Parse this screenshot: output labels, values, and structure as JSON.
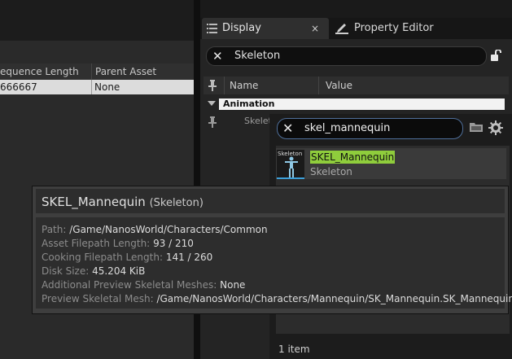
{
  "left_table": {
    "columns": [
      "equence Length",
      "Parent Asset"
    ],
    "row": [
      "666667",
      "None"
    ]
  },
  "tabs": {
    "display": {
      "label": "Display",
      "close": "×"
    },
    "property_editor": {
      "label": "Property Editor"
    }
  },
  "details_search": {
    "value": "Skeleton",
    "clear": "✕"
  },
  "property_grid": {
    "headers": [
      "Name",
      "Value"
    ],
    "category": "Animation",
    "row_label": "Skelet"
  },
  "picker": {
    "search": {
      "value": "skel_mannequin",
      "clear": "✕"
    },
    "items": [
      {
        "name": "SKEL_Mannequin",
        "type": "Skeleton",
        "thumb_label": "Skeleton"
      }
    ],
    "count": "1 item",
    "highlight_color": "#8fcd3c"
  },
  "tooltip": {
    "name": "SKEL_Mannequin",
    "type": "(Skeleton)",
    "lines": [
      {
        "key": "Path:",
        "value": "/Game/NanosWorld/Characters/Common"
      },
      {
        "key": "Asset Filepath Length:",
        "value": "93 / 210"
      },
      {
        "key": "Cooking Filepath Length:",
        "value": "141 / 260"
      },
      {
        "key": "Disk Size:",
        "value": "45.204 KiB"
      },
      {
        "key": "Additional Preview Skeletal Meshes:",
        "value": "None"
      },
      {
        "key": "Preview Skeletal Mesh:",
        "value": "/Game/NanosWorld/Characters/Mannequin/SK_Mannequin.SK_Mannequin"
      }
    ]
  },
  "icons": [
    "list-icon",
    "pencil-icon",
    "lock-icon",
    "pin-icon",
    "folder-icon",
    "gear-icon",
    "close-icon",
    "expand-triangle-icon"
  ]
}
